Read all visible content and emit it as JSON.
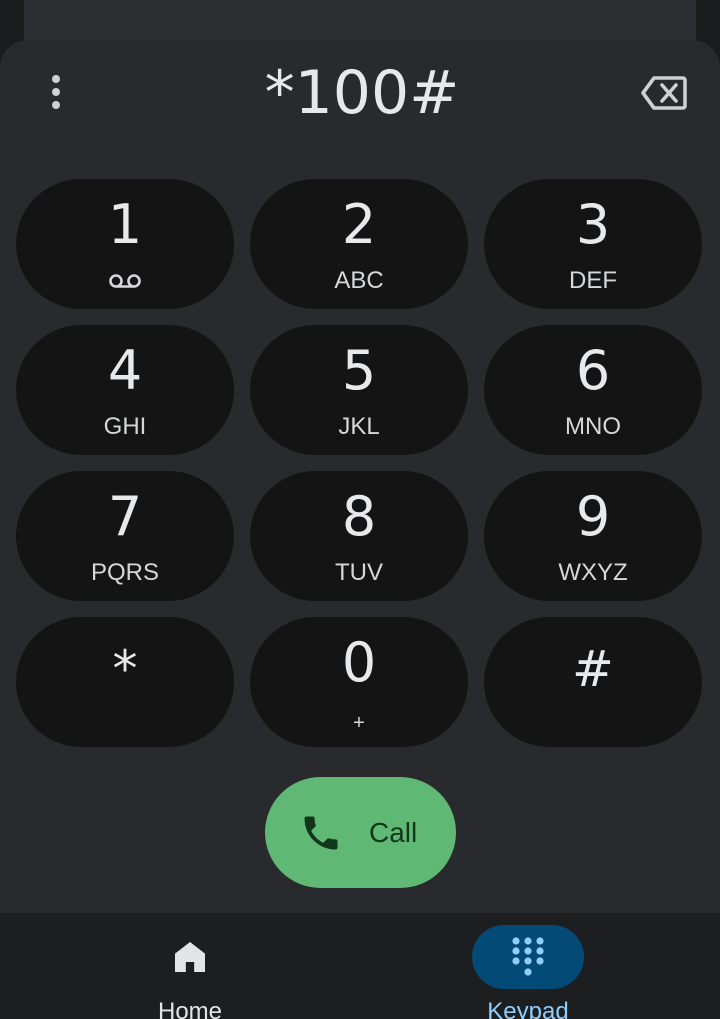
{
  "dialer": {
    "number": "*100#",
    "menu_icon": "more-vert-icon",
    "backspace_icon": "backspace-icon"
  },
  "keys": [
    {
      "digit": "1",
      "letters": "",
      "icon": "voicemail-icon"
    },
    {
      "digit": "2",
      "letters": "ABC"
    },
    {
      "digit": "3",
      "letters": "DEF"
    },
    {
      "digit": "4",
      "letters": "GHI"
    },
    {
      "digit": "5",
      "letters": "JKL"
    },
    {
      "digit": "6",
      "letters": "MNO"
    },
    {
      "digit": "7",
      "letters": "PQRS"
    },
    {
      "digit": "8",
      "letters": "TUV"
    },
    {
      "digit": "9",
      "letters": "WXYZ"
    },
    {
      "digit": "*",
      "letters": ""
    },
    {
      "digit": "0",
      "letters": "+"
    },
    {
      "digit": "#",
      "letters": ""
    }
  ],
  "call": {
    "label": "Call",
    "icon": "phone-icon",
    "color": "#5fb873"
  },
  "nav": {
    "items": [
      {
        "label": "Home",
        "icon": "home-icon",
        "active": false
      },
      {
        "label": "Keypad",
        "icon": "dialpad-icon",
        "active": true
      }
    ],
    "active_color": "#8fcdfd",
    "active_pill_color": "#044a76"
  }
}
